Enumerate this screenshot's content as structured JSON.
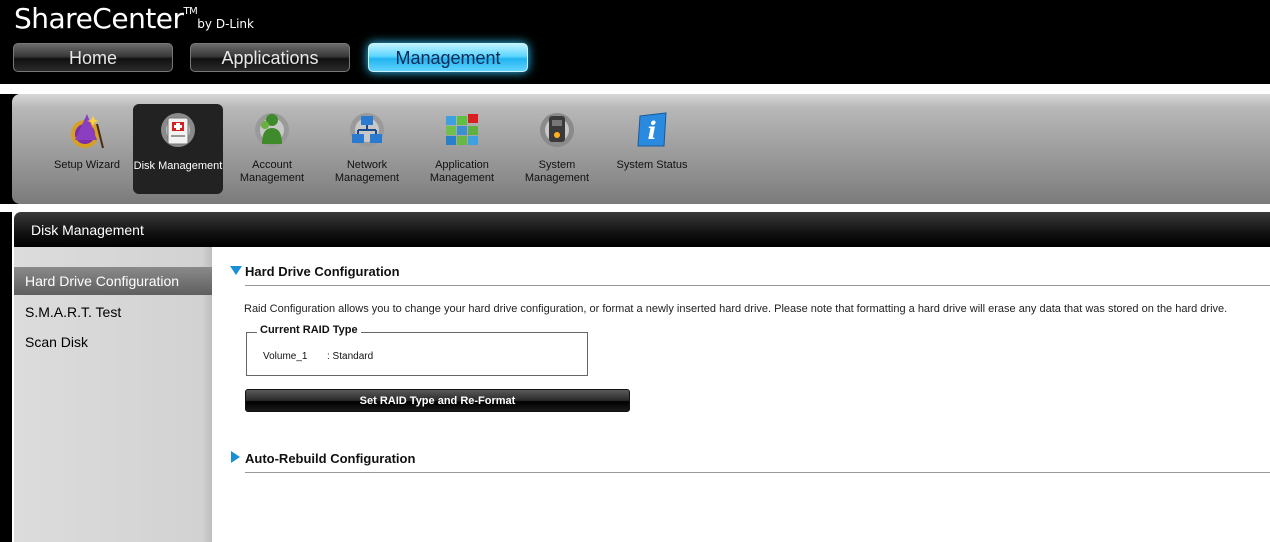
{
  "brand": {
    "name": "ShareCenter",
    "tm": "TM",
    "by": "by D-Link"
  },
  "nav": {
    "home": "Home",
    "applications": "Applications",
    "management": "Management",
    "active": "Management"
  },
  "toolbar": {
    "items": [
      {
        "label": "Setup Wizard",
        "icon": "wizard-icon"
      },
      {
        "label": "Disk Management",
        "icon": "disk-management-icon",
        "active": true
      },
      {
        "label": "Account Management",
        "icon": "account-management-icon"
      },
      {
        "label": "Network Management",
        "icon": "network-management-icon"
      },
      {
        "label": "Application Management",
        "icon": "application-management-icon"
      },
      {
        "label": "System Management",
        "icon": "system-management-icon"
      },
      {
        "label": "System Status",
        "icon": "info-icon"
      }
    ]
  },
  "panel": {
    "title": "Disk Management"
  },
  "sidebar": {
    "items": [
      {
        "label": "Hard Drive Configuration",
        "active": true
      },
      {
        "label": "S.M.A.R.T. Test"
      },
      {
        "label": "Scan Disk"
      }
    ]
  },
  "content": {
    "section1": {
      "title": "Hard Drive Configuration",
      "expanded": true,
      "description": "Raid Configuration allows you to change your hard drive configuration, or format a newly inserted hard drive. Please note that formatting a hard drive will erase any data that was stored on the hard drive.",
      "raid_box": {
        "legend": "Current RAID Type",
        "volume": "Volume_1",
        "value": ": Standard"
      },
      "button": "Set RAID Type and Re-Format"
    },
    "section2": {
      "title": "Auto-Rebuild Configuration",
      "expanded": false
    }
  },
  "colors": {
    "accent": "#1a8fd8",
    "active_tab_glow": "#32c8ff"
  }
}
